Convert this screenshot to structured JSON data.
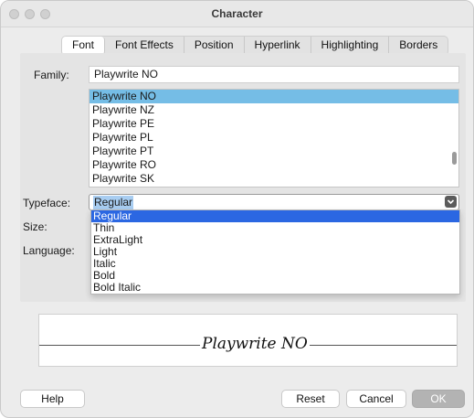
{
  "window": {
    "title": "Character"
  },
  "tabs": [
    {
      "label": "Font"
    },
    {
      "label": "Font Effects"
    },
    {
      "label": "Position"
    },
    {
      "label": "Hyperlink"
    },
    {
      "label": "Highlighting"
    },
    {
      "label": "Borders"
    }
  ],
  "active_tab": "Font",
  "family": {
    "label": "Family:",
    "value": "Playwrite NO",
    "list": [
      "Playwrite NO",
      "Playwrite NZ",
      "Playwrite PE",
      "Playwrite PL",
      "Playwrite PT",
      "Playwrite RO",
      "Playwrite SK"
    ],
    "selected": "Playwrite NO"
  },
  "typeface": {
    "label": "Typeface:",
    "value": "Regular",
    "options": [
      "Regular",
      "Thin",
      "ExtraLight",
      "Light",
      "Italic",
      "Bold",
      "Bold Italic"
    ],
    "selected": "Regular"
  },
  "size": {
    "label": "Size:"
  },
  "language": {
    "label": "Language:"
  },
  "preview": {
    "text": "Playwrite NO"
  },
  "buttons": {
    "help": "Help",
    "reset": "Reset",
    "cancel": "Cancel",
    "ok": "OK"
  },
  "colors": {
    "list_selection": "#75bde6",
    "dropdown_selection": "#2b67e2",
    "ok_button": "#b3b3b3"
  }
}
